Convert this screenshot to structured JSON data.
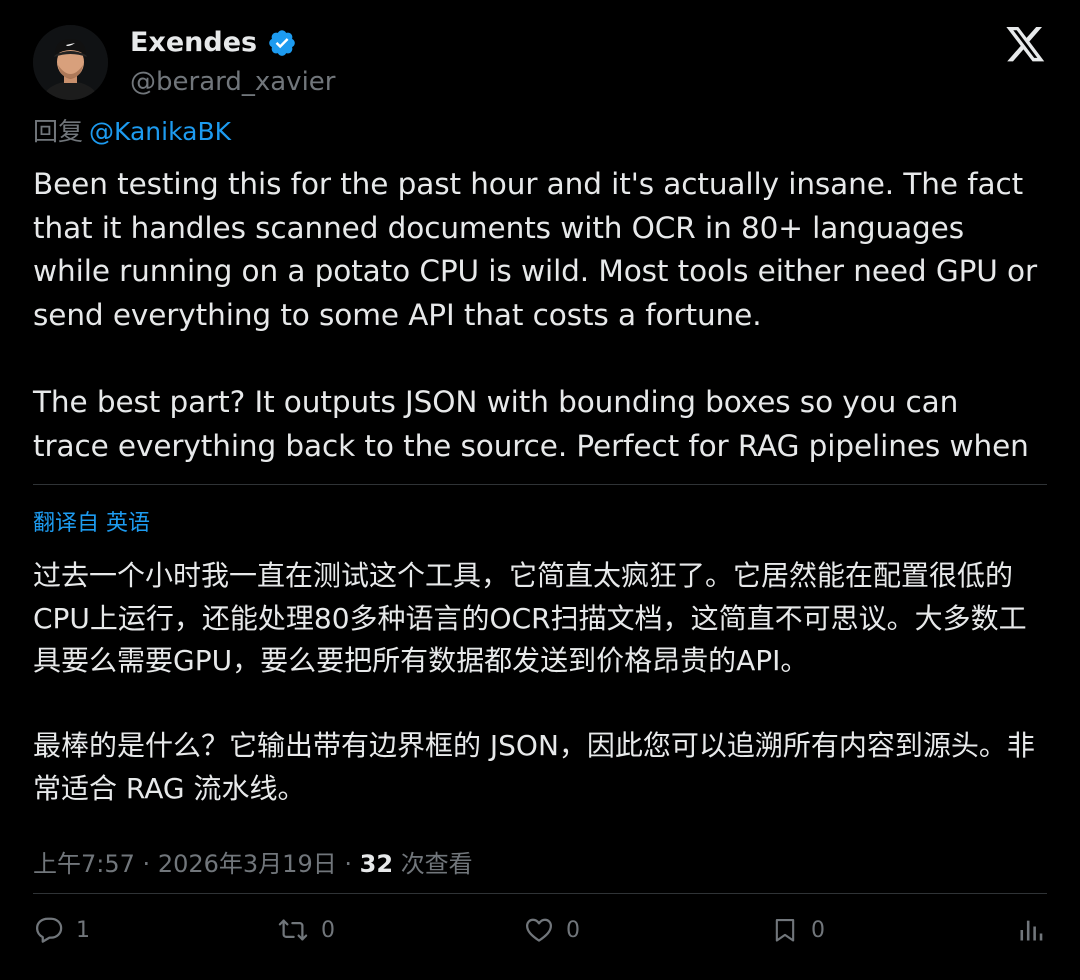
{
  "author": {
    "display_name": "Exendes",
    "handle": "@berard_xavier",
    "verified_icon": "verified-badge-icon",
    "avatar_icon": "profile-photo"
  },
  "brand_icon": "x-logo-icon",
  "reply": {
    "prefix": "回复",
    "mention": "@KanikaBK"
  },
  "tweet": {
    "paragraphs": [
      "Been testing this for the past hour and it's actually insane. The fact that it handles scanned documents with OCR in 80+ languages while running on a potato CPU is wild. Most tools either need GPU or send everything to some API that costs a fortune.",
      "The best part? It outputs JSON with bounding boxes so you can trace everything back to the source. Perfect for RAG pipelines when"
    ]
  },
  "translation": {
    "label": "翻译自 英语",
    "paragraphs": [
      "过去一个小时我一直在测试这个工具，它简直太疯狂了。它居然能在配置很低的CPU上运行，还能处理80多种语言的OCR扫描文档，这简直不可思议。大多数工具要么需要GPU，要么要把所有数据都发送到价格昂贵的API。",
      "最棒的是什么？它输出带有边界框的 JSON，因此您可以追溯所有内容到源头。非常适合 RAG 流水线。"
    ]
  },
  "meta": {
    "time": "上午7:57",
    "date": "2026年3月19日",
    "separator": "·",
    "views_count": "32",
    "views_label": "次查看"
  },
  "actions": {
    "reply_count": "1",
    "repost_count": "0",
    "like_count": "0",
    "bookmark_count": "0",
    "reply_icon": "reply-icon",
    "repost_icon": "repost-icon",
    "like_icon": "heart-icon",
    "bookmark_icon": "bookmark-icon",
    "analytics_icon": "analytics-icon"
  },
  "colors": {
    "background": "#000000",
    "text": "#e7e9ea",
    "muted": "#71767b",
    "accent": "#1d9bf0",
    "divider": "#2f3336"
  }
}
